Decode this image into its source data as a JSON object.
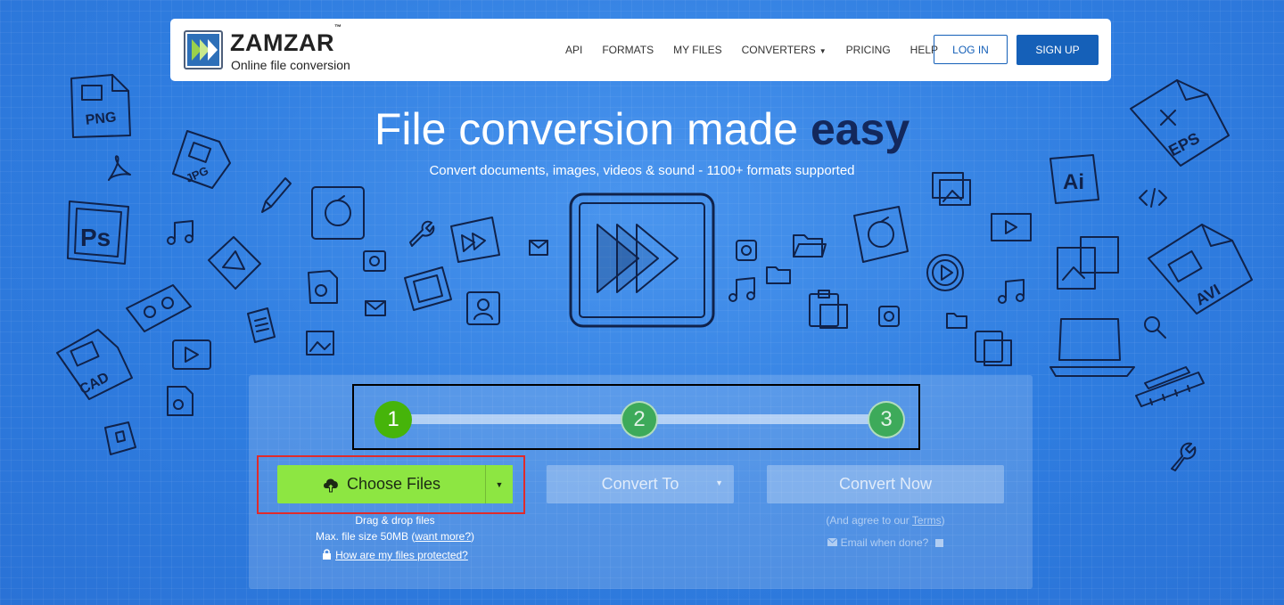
{
  "header": {
    "brand": "ZAMZAR",
    "tm": "™",
    "tagline": "Online file conversion",
    "nav": [
      "API",
      "FORMATS",
      "MY FILES",
      "CONVERTERS",
      "PRICING",
      "HELP"
    ],
    "login_label": "LOG IN",
    "signup_label": "SIGN UP"
  },
  "hero": {
    "title_main": "File conversion made ",
    "title_bold": "easy",
    "subtitle": "Convert documents, images, videos & sound - 1100+ formats supported"
  },
  "doodles": {
    "png": "PNG",
    "jpg": "JPG",
    "ps": "Ps",
    "cad": "CAD",
    "eps": "EPS",
    "ai": "Ai",
    "avi": "AVI"
  },
  "converter": {
    "steps": [
      "1",
      "2",
      "3"
    ],
    "choose_label": "Choose Files",
    "convert_to_label": "Convert To",
    "convert_now_label": "Convert Now",
    "drag_drop": "Drag & drop files",
    "max_size": "Max. file size 50MB (",
    "want_more": "want more?",
    "max_size_end": ")",
    "protected_link": "How are my files protected?",
    "agree_prefix": "(And agree to our ",
    "terms": "Terms",
    "agree_suffix": ")",
    "email_label": "Email when done?"
  },
  "colors": {
    "background": "#2f7de0",
    "brand_blue": "#1560b8",
    "choose_green": "#8de642",
    "step_active": "#46b40a",
    "highlight_red": "#e02b2b"
  }
}
